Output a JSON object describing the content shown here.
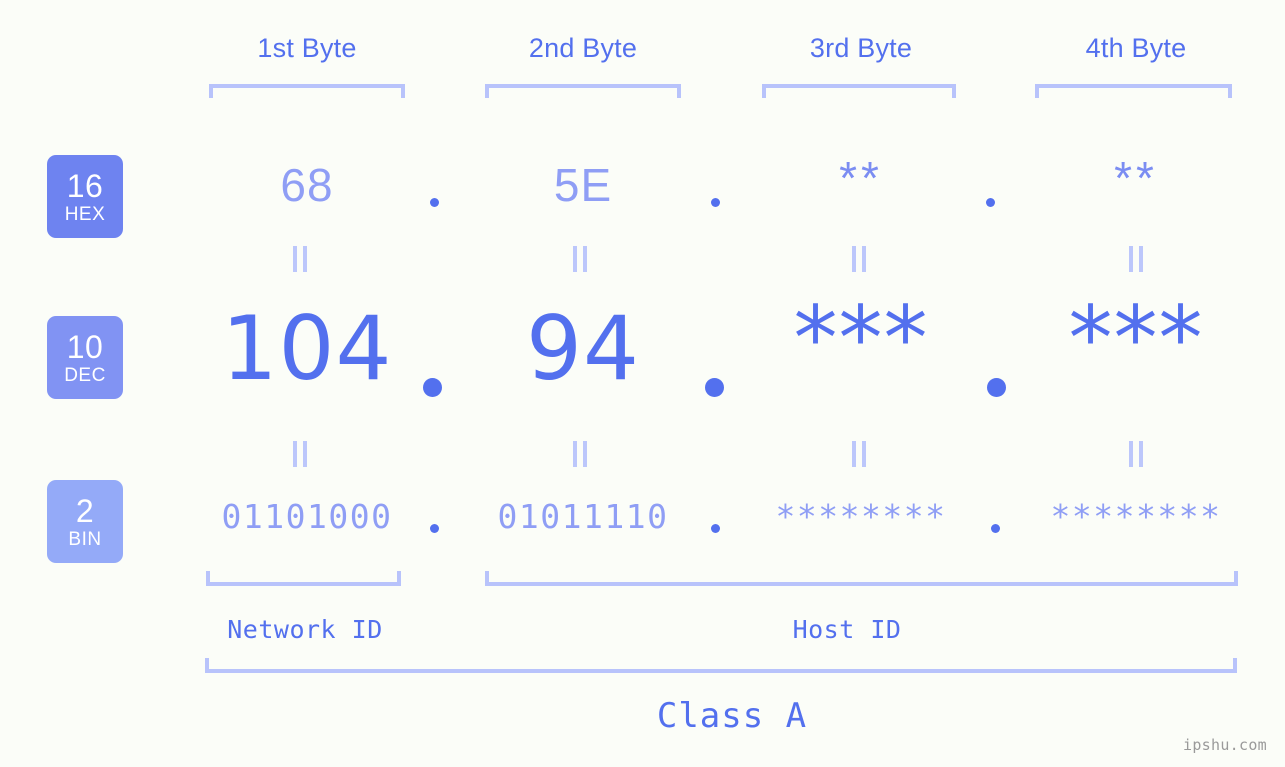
{
  "site": {
    "watermark": "ipshu.com"
  },
  "columns": [
    {
      "header": "1st Byte",
      "hex": "68",
      "dec": "104",
      "bin": "01101000"
    },
    {
      "header": "2nd Byte",
      "hex": "5E",
      "dec": "94",
      "bin": "01011110"
    },
    {
      "header": "3rd Byte",
      "hex": "**",
      "dec": "***",
      "bin": "********"
    },
    {
      "header": "4th Byte",
      "hex": "**",
      "dec": "***",
      "bin": "********"
    }
  ],
  "rows": [
    {
      "base": "16",
      "name": "HEX",
      "color": "#6e83f0"
    },
    {
      "base": "10",
      "name": "DEC",
      "color": "#8193f3"
    },
    {
      "base": "2",
      "name": "BIN",
      "color": "#94aaf8"
    }
  ],
  "separators": {
    "dot": "."
  },
  "equals_marks": {
    "symbol": "="
  },
  "segments": [
    {
      "label": "Network ID"
    },
    {
      "label": "Host ID"
    }
  ],
  "class": {
    "label": "Class A"
  },
  "colors": {
    "background": "#fbfdf8",
    "primary": "#5370ee",
    "light": "#8f9ef5",
    "bracket": "#b8c3fb"
  }
}
